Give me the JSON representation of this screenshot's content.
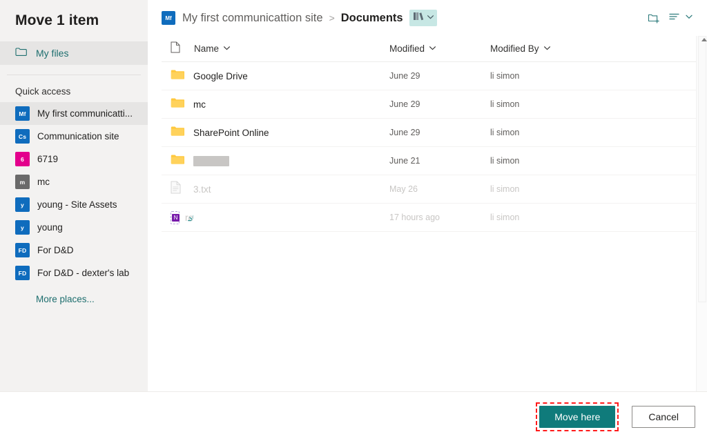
{
  "dialog": {
    "title": "Move 1 item"
  },
  "sidebar": {
    "my_files": {
      "label": "My files",
      "icon": "folder-icon"
    },
    "quick_access_header": "Quick access",
    "items": [
      {
        "label": "My first communicatti...",
        "tile": "Mf",
        "tile_color": "#0f6cbd",
        "selected": true
      },
      {
        "label": "Communication site",
        "tile": "Cs",
        "tile_color": "#0f6cbd",
        "selected": false
      },
      {
        "label": "6719",
        "tile": "6",
        "tile_color": "#e3008c",
        "selected": false
      },
      {
        "label": "mc",
        "tile": "m",
        "tile_color": "#6a6a6a",
        "selected": false
      },
      {
        "label": "young - Site Assets",
        "tile": "y",
        "tile_color": "#0f6cbd",
        "selected": false
      },
      {
        "label": "young",
        "tile": "y",
        "tile_color": "#0f6cbd",
        "selected": false
      },
      {
        "label": "For D&D",
        "tile": "FD",
        "tile_color": "#0f6cbd",
        "selected": false
      },
      {
        "label": "For D&D - dexter's lab",
        "tile": "FD",
        "tile_color": "#0f6cbd",
        "selected": false
      }
    ],
    "more_places": "More places..."
  },
  "breadcrumb": {
    "site_tile": "Mf",
    "site": "My first communicattion site",
    "separator": ">",
    "current": "Documents",
    "library_chip_icon": "library-books-icon",
    "library_chip_chevron": "chevron-down-icon"
  },
  "toolbar": {
    "new_folder_icon": "new-folder-icon",
    "sort_icon": "sort-list-icon",
    "sort_chevron": "chevron-down-icon"
  },
  "table": {
    "columns": [
      {
        "key": "icon",
        "label": "",
        "icon": "file-type-icon"
      },
      {
        "key": "name",
        "label": "Name",
        "chevron": "chevron-down-icon"
      },
      {
        "key": "modified",
        "label": "Modified",
        "chevron": "chevron-down-icon"
      },
      {
        "key": "modified_by",
        "label": "Modified By",
        "chevron": "chevron-down-icon"
      }
    ],
    "rows": [
      {
        "icon": "folder-icon",
        "name": "Google Drive",
        "modified": "June 29",
        "modified_by": "li simon",
        "state": "normal"
      },
      {
        "icon": "folder-icon",
        "name": "mc",
        "modified": "June 29",
        "modified_by": "li simon",
        "state": "normal"
      },
      {
        "icon": "folder-icon",
        "name": "SharePoint Online",
        "modified": "June 29",
        "modified_by": "li simon",
        "state": "normal"
      },
      {
        "icon": "folder-icon",
        "name": "",
        "modified": "June 21",
        "modified_by": "li simon",
        "state": "redacted"
      },
      {
        "icon": "text-file-icon",
        "name": "3.txt",
        "modified": "May 26",
        "modified_by": "li simon",
        "state": "disabled"
      },
      {
        "icon": "onenote-icon",
        "name": "re",
        "modified": "17 hours ago",
        "modified_by": "li simon",
        "state": "pending"
      }
    ]
  },
  "footer": {
    "primary_label": "Move here",
    "cancel_label": "Cancel",
    "primary_color": "#0f7b7b",
    "highlight_color": "#ff1a1a"
  },
  "scrollbar": {
    "arrow_up_icon": "caret-up-icon"
  }
}
